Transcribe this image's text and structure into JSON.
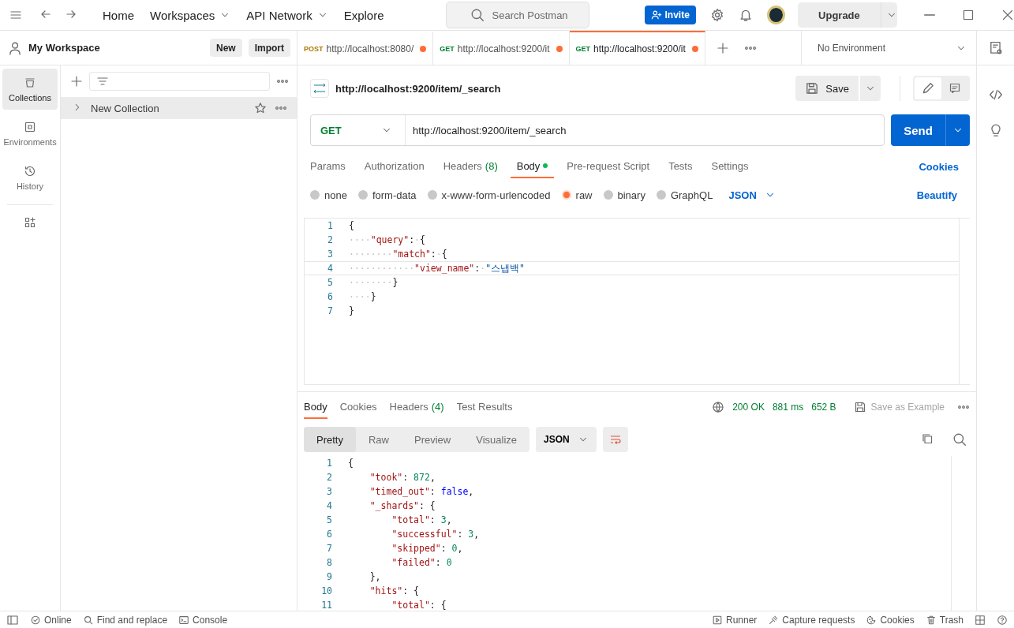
{
  "top_bar": {
    "nav": [
      {
        "label": "Home",
        "dropdown": false
      },
      {
        "label": "Workspaces",
        "dropdown": true
      },
      {
        "label": "API Network",
        "dropdown": true
      },
      {
        "label": "Explore",
        "dropdown": false
      }
    ],
    "search": {
      "placeholder": "Search Postman"
    },
    "invite": "Invite",
    "upgrade": "Upgrade"
  },
  "sidebar": {
    "workspace": "My Workspace",
    "buttons": [
      "New",
      "Import"
    ],
    "nav": [
      {
        "label": "Collections",
        "kind": "collections",
        "selected": true
      },
      {
        "label": "Environments",
        "kind": "environments",
        "selected": false
      },
      {
        "label": "History",
        "kind": "history",
        "selected": false
      }
    ],
    "collections": [
      {
        "name": "New Collection",
        "expanded": false
      }
    ]
  },
  "request_tabs": [
    {
      "method": "POST",
      "url": "http://localhost:8080/",
      "unsaved": true,
      "selected": false
    },
    {
      "method": "GET",
      "url": "http://localhost:9200/it",
      "unsaved": true,
      "selected": false
    },
    {
      "method": "GET",
      "url": "http://localhost:9200/it",
      "unsaved": true,
      "selected": true
    }
  ],
  "environment": "No Environment",
  "request": {
    "title": "http://localhost:9200/item/_search",
    "save": "Save",
    "method": "GET",
    "url": "http://localhost:9200/item/_search",
    "send": "Send",
    "tabs": [
      {
        "label": "Params",
        "selected": false
      },
      {
        "label": "Authorization",
        "selected": false
      },
      {
        "label": "Headers",
        "count": "(8)",
        "selected": false
      },
      {
        "label": "Body",
        "has_content": true,
        "selected": true
      },
      {
        "label": "Pre-request Script",
        "selected": false
      },
      {
        "label": "Tests",
        "selected": false
      },
      {
        "label": "Settings",
        "selected": false
      }
    ],
    "cookies": "Cookies",
    "body_types": [
      {
        "label": "none",
        "selected": false
      },
      {
        "label": "form-data",
        "selected": false
      },
      {
        "label": "x-www-form-urlencoded",
        "selected": false
      },
      {
        "label": "raw",
        "selected": true
      },
      {
        "label": "binary",
        "selected": false
      },
      {
        "label": "GraphQL",
        "selected": false
      }
    ],
    "format": "JSON",
    "beautify": "Beautify",
    "body_lines": [
      {
        "num": "1",
        "active": false,
        "tokens": [
          {
            "kind": "punct",
            "text": "{"
          }
        ]
      },
      {
        "num": "2",
        "active": false,
        "tokens": [
          {
            "kind": "ws",
            "text": "····"
          },
          {
            "kind": "key",
            "text": "\"query\""
          },
          {
            "kind": "punct",
            "text": ":"
          },
          {
            "kind": "ws",
            "text": "·"
          },
          {
            "kind": "punct",
            "text": "{"
          }
        ]
      },
      {
        "num": "3",
        "active": false,
        "tokens": [
          {
            "kind": "ws",
            "text": "········"
          },
          {
            "kind": "key",
            "text": "\"match\""
          },
          {
            "kind": "punct",
            "text": ":"
          },
          {
            "kind": "ws",
            "text": "·"
          },
          {
            "kind": "punct",
            "text": "{"
          }
        ]
      },
      {
        "num": "4",
        "active": true,
        "tokens": [
          {
            "kind": "ws",
            "text": "············"
          },
          {
            "kind": "key",
            "text": "\"view_name\""
          },
          {
            "kind": "punct",
            "text": ":"
          },
          {
            "kind": "ws",
            "text": "·"
          },
          {
            "kind": "str",
            "text": "\"스냅백\""
          }
        ]
      },
      {
        "num": "5",
        "active": false,
        "tokens": [
          {
            "kind": "ws",
            "text": "········"
          },
          {
            "kind": "punct",
            "text": "}"
          }
        ]
      },
      {
        "num": "6",
        "active": false,
        "tokens": [
          {
            "kind": "ws",
            "text": "····"
          },
          {
            "kind": "punct",
            "text": "}"
          }
        ]
      },
      {
        "num": "7",
        "active": false,
        "tokens": [
          {
            "kind": "punct",
            "text": "}"
          }
        ]
      }
    ]
  },
  "response": {
    "tabs": [
      {
        "label": "Body",
        "selected": true
      },
      {
        "label": "Cookies",
        "selected": false
      },
      {
        "label": "Headers",
        "count": "(4)",
        "selected": false
      },
      {
        "label": "Test Results",
        "selected": false
      }
    ],
    "status": "200 OK",
    "time": "881 ms",
    "size": "652 B",
    "save_example": "Save as Example",
    "views": [
      {
        "label": "Pretty",
        "selected": true
      },
      {
        "label": "Raw",
        "selected": false
      },
      {
        "label": "Preview",
        "selected": false
      },
      {
        "label": "Visualize",
        "selected": false
      }
    ],
    "format": "JSON",
    "lines": [
      {
        "num": "1",
        "tokens": [
          {
            "kind": "punct",
            "text": "{"
          }
        ]
      },
      {
        "num": "2",
        "tokens": [
          {
            "kind": "key",
            "text": "    \"took\""
          },
          {
            "kind": "punct",
            "text": ": "
          },
          {
            "kind": "num",
            "text": "872"
          },
          {
            "kind": "punct",
            "text": ","
          }
        ]
      },
      {
        "num": "3",
        "tokens": [
          {
            "kind": "key",
            "text": "    \"timed_out\""
          },
          {
            "kind": "punct",
            "text": ": "
          },
          {
            "kind": "bool",
            "text": "false"
          },
          {
            "kind": "punct",
            "text": ","
          }
        ]
      },
      {
        "num": "4",
        "tokens": [
          {
            "kind": "key",
            "text": "    \"_shards\""
          },
          {
            "kind": "punct",
            "text": ": {"
          }
        ]
      },
      {
        "num": "5",
        "tokens": [
          {
            "kind": "key",
            "text": "        \"total\""
          },
          {
            "kind": "punct",
            "text": ": "
          },
          {
            "kind": "num",
            "text": "3"
          },
          {
            "kind": "punct",
            "text": ","
          }
        ]
      },
      {
        "num": "6",
        "tokens": [
          {
            "kind": "key",
            "text": "        \"successful\""
          },
          {
            "kind": "punct",
            "text": ": "
          },
          {
            "kind": "num",
            "text": "3"
          },
          {
            "kind": "punct",
            "text": ","
          }
        ]
      },
      {
        "num": "7",
        "tokens": [
          {
            "kind": "key",
            "text": "        \"skipped\""
          },
          {
            "kind": "punct",
            "text": ": "
          },
          {
            "kind": "num",
            "text": "0"
          },
          {
            "kind": "punct",
            "text": ","
          }
        ]
      },
      {
        "num": "8",
        "tokens": [
          {
            "kind": "key",
            "text": "        \"failed\""
          },
          {
            "kind": "punct",
            "text": ": "
          },
          {
            "kind": "num",
            "text": "0"
          }
        ]
      },
      {
        "num": "9",
        "tokens": [
          {
            "kind": "punct",
            "text": "    },"
          }
        ]
      },
      {
        "num": "10",
        "tokens": [
          {
            "kind": "key",
            "text": "    \"hits\""
          },
          {
            "kind": "punct",
            "text": ": {"
          }
        ]
      },
      {
        "num": "11",
        "tokens": [
          {
            "kind": "key",
            "text": "        \"total\""
          },
          {
            "kind": "punct",
            "text": ": {"
          }
        ]
      }
    ]
  },
  "status_bar": {
    "left": [
      {
        "label": "Online",
        "kind": "online"
      },
      {
        "label": "Find and replace",
        "kind": "find"
      },
      {
        "label": "Console",
        "kind": "console"
      }
    ],
    "right": [
      {
        "label": "Runner",
        "kind": "runner"
      },
      {
        "label": "Capture requests",
        "kind": "capture"
      },
      {
        "label": "Cookies",
        "kind": "cookies"
      },
      {
        "label": "Trash",
        "kind": "trash"
      }
    ]
  }
}
